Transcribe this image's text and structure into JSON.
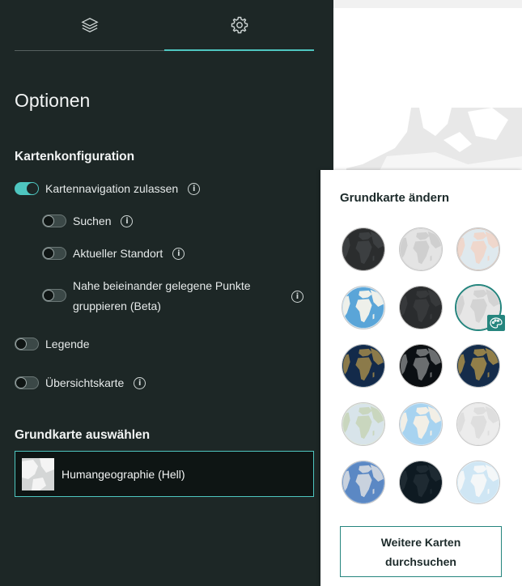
{
  "tabs": [
    {
      "icon": "layers-icon"
    },
    {
      "icon": "gear-icon",
      "active": true
    }
  ],
  "panel": {
    "title": "Optionen",
    "map_config": {
      "heading": "Kartenkonfiguration",
      "options": [
        {
          "label": "Kartennavigation zulassen",
          "on": true
        },
        {
          "label": "Suchen",
          "on": false
        },
        {
          "label": "Aktueller Standort",
          "on": false
        },
        {
          "label": "Nahe beieinander gelegene Punkte gruppieren (Beta)",
          "line1": "Nahe beieinander gelegene Punkte",
          "line2": "gruppieren (Beta)",
          "on": false
        },
        {
          "label": "Legende",
          "on": false
        },
        {
          "label": "Übersichtskarte",
          "on": false
        }
      ]
    },
    "basemap": {
      "heading": "Grundkarte auswählen",
      "selected": "Humangeographie (Hell)"
    }
  },
  "gallery": {
    "title": "Grundkarte ändern",
    "selected_index": 5,
    "thumbnails": [
      "dark-gray-globe",
      "light-gray-globe",
      "topographic-globe",
      "oceans-globe",
      "dark-navigation-globe",
      "human-geography-light-globe",
      "imagery-globe",
      "imagery-dark-globe",
      "imagery-hybrid-globe",
      "terrain-globe",
      "light-blue-globe",
      "light-canvas-globe",
      "blue-imagery-globe",
      "night-globe",
      "pale-blue-globe"
    ],
    "more_button": {
      "line1": "Weitere Karten",
      "line2": "durchsuchen"
    }
  },
  "colors": {
    "accent": "#4ec6c0",
    "accent_dark": "#25857e",
    "panel_bg": "#1d2726"
  }
}
